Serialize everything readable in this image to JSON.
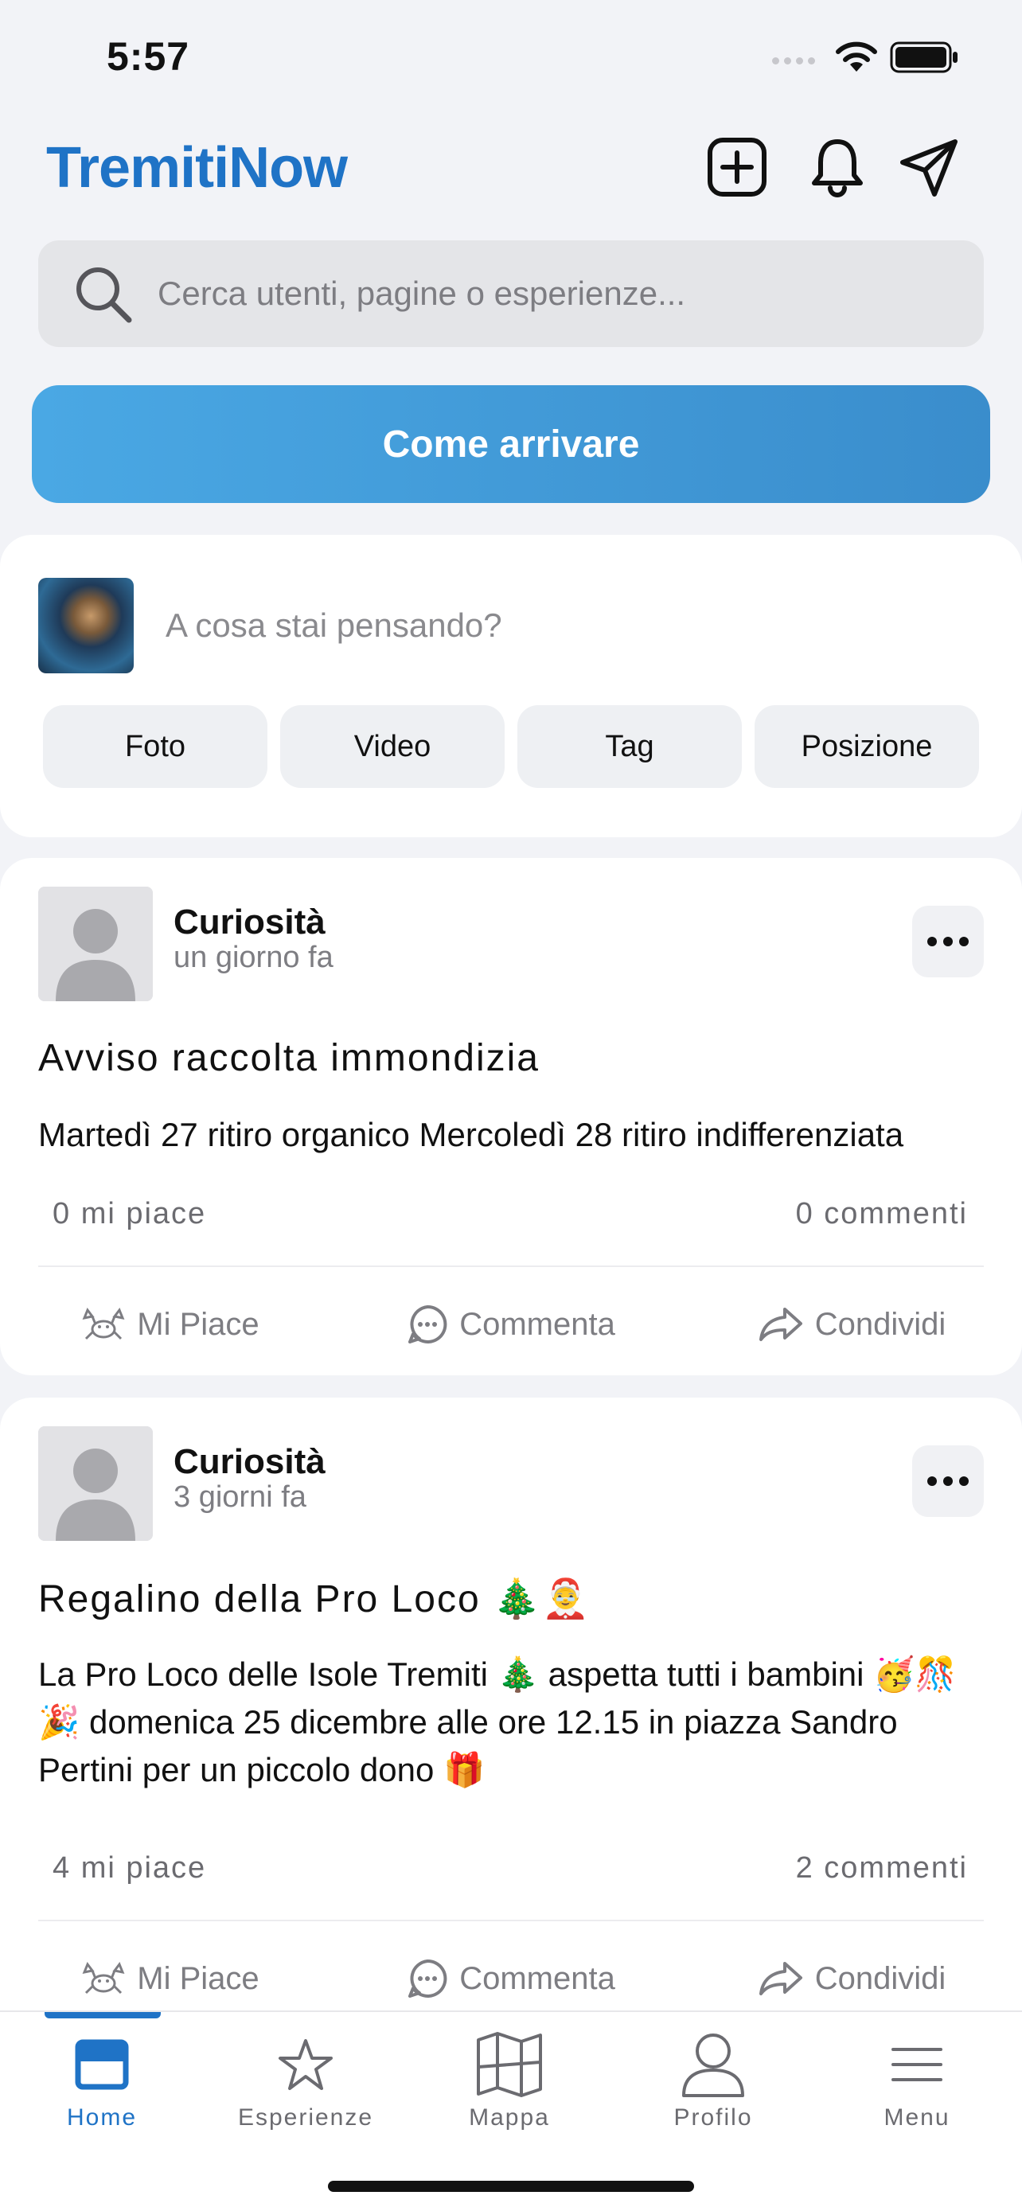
{
  "status_bar": {
    "time": "5:57"
  },
  "header": {
    "logo_part1": "Tremiti",
    "logo_part2": "Now",
    "icons": [
      "add-post-icon",
      "bell-icon",
      "send-icon"
    ]
  },
  "search": {
    "placeholder": "Cerca utenti, pagine o esperienze..."
  },
  "cta": {
    "label": "Come arrivare"
  },
  "composer": {
    "prompt": "A cosa stai pensando?",
    "chips": [
      "Foto",
      "Video",
      "Tag",
      "Posizione"
    ]
  },
  "posts": [
    {
      "author": "Curiosità",
      "time": "un giorno fa",
      "title": "Avviso raccolta immondizia",
      "body": "Martedì 27 ritiro organico Mercoledì 28 ritiro indifferenziata",
      "likes": "0 mi piace",
      "comments": "0 commenti",
      "actions": {
        "like": "Mi Piace",
        "comment": "Commenta",
        "share": "Condividi"
      }
    },
    {
      "author": "Curiosità",
      "time": "3 giorni fa",
      "title": "Regalino della Pro Loco 🎄🤶",
      "body": "La Pro Loco delle Isole Tremiti 🎄 aspetta tutti i bambini 🥳🎊🎉 domenica 25 dicembre alle ore 12.15 in piazza Sandro Pertini per un piccolo dono 🎁",
      "likes": "4 mi piace",
      "comments": "2 commenti",
      "actions": {
        "like": "Mi Piace",
        "comment": "Commenta",
        "share": "Condividi"
      }
    }
  ],
  "tabbar": {
    "tabs": [
      {
        "label": "Home",
        "icon": "home-icon",
        "active": true
      },
      {
        "label": "Esperienze",
        "icon": "star-icon",
        "active": false
      },
      {
        "label": "Mappa",
        "icon": "map-icon",
        "active": false
      },
      {
        "label": "Profilo",
        "icon": "person-icon",
        "active": false
      },
      {
        "label": "Menu",
        "icon": "hamburger-icon",
        "active": false
      }
    ]
  },
  "colors": {
    "accent": "#1f73c6",
    "cta_start": "#4aa8e4",
    "cta_end": "#3a8dcc"
  }
}
